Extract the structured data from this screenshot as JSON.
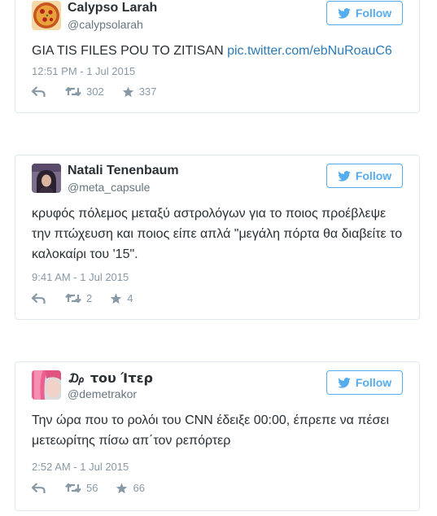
{
  "tweets": [
    {
      "name": "Calypso Larah",
      "handle": "@calypsolarah",
      "follow_label": "Follow",
      "text": "GIA TIS FILES POU TO ZITISAN ",
      "link": "pic.twitter.com/ebNuRoauC6",
      "time": "12:51 PM - 1 Jul 2015",
      "retweets": "302",
      "likes": "337",
      "avatar_icon": "pizza-avatar"
    },
    {
      "name": "Natali Tenenbaum",
      "handle": "@meta_capsule",
      "follow_label": "Follow",
      "text": "κρυφός πόλεμος μεταξύ αστρολόγων για το ποιος προέβλεψε την πτώχευση και ποιος είπε απλά \"μεγάλη πόρτα θα διαβείτε το καλοκαίρι του '15\".",
      "link": "",
      "time": "9:41 AM - 1 Jul 2015",
      "retweets": "2",
      "likes": "4",
      "avatar_icon": "person-avatar"
    },
    {
      "name": "₯ του Ίτερ",
      "handle": "@demetrakor",
      "follow_label": "Follow",
      "text": "Την ώρα που το ρολόι του CNN έδειξε 00:00, έπρεπε να πέσει μετεωρίτης πίσω απ΄τον ρεπόρτερ",
      "link": "",
      "time": "2:52 AM - 1 Jul 2015",
      "retweets": "56",
      "likes": "66",
      "avatar_icon": "pink-hair-avatar"
    }
  ],
  "colors": {
    "accent": "#55acee",
    "link": "#2b7bb9",
    "muted": "#8899a6",
    "border": "#e1e8ed"
  }
}
